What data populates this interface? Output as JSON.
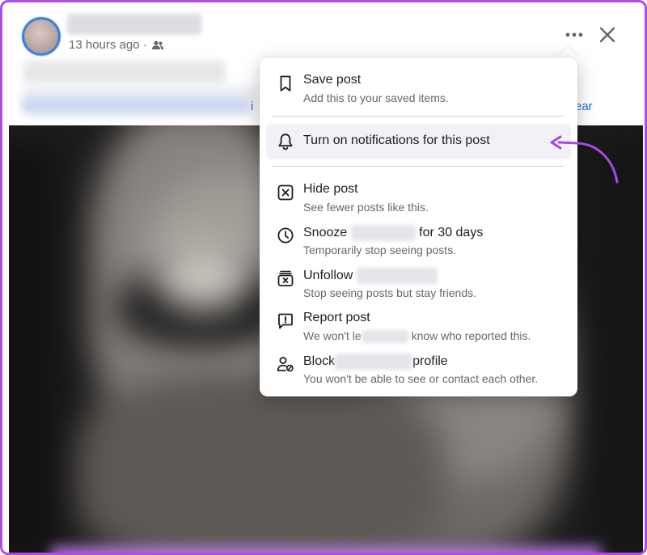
{
  "post": {
    "timestamp": "13 hours ago ·",
    "audience_icon": "friends-icon",
    "link_fragment_left": "i",
    "link_fragment_right": "ear"
  },
  "menu": {
    "items": [
      {
        "title": "Save post",
        "subtitle": "Add this to your saved items.",
        "icon": "bookmark-icon"
      },
      {
        "title": "Turn on notifications for this post",
        "icon": "bell-icon"
      },
      {
        "title": "Hide post",
        "subtitle": "See fewer posts like this.",
        "icon": "hide-icon"
      },
      {
        "title_prefix": "Snooze",
        "title_suffix": "for 30 days",
        "subtitle": "Temporarily stop seeing posts.",
        "icon": "clock-icon"
      },
      {
        "title": "Unfollow",
        "subtitle": "Stop seeing posts but stay friends.",
        "icon": "unfollow-icon"
      },
      {
        "title": "Report post",
        "subtitle_prefix": "We won't le",
        "subtitle_suffix": "know who reported this.",
        "icon": "report-icon"
      },
      {
        "title_prefix": "Block",
        "title_suffix": "profile",
        "subtitle": "You won't be able to see or contact each other.",
        "icon": "block-icon"
      }
    ]
  },
  "colors": {
    "accent": "#216fdb",
    "annotation": "#a24be6",
    "frame_border": "#b04ae8"
  }
}
